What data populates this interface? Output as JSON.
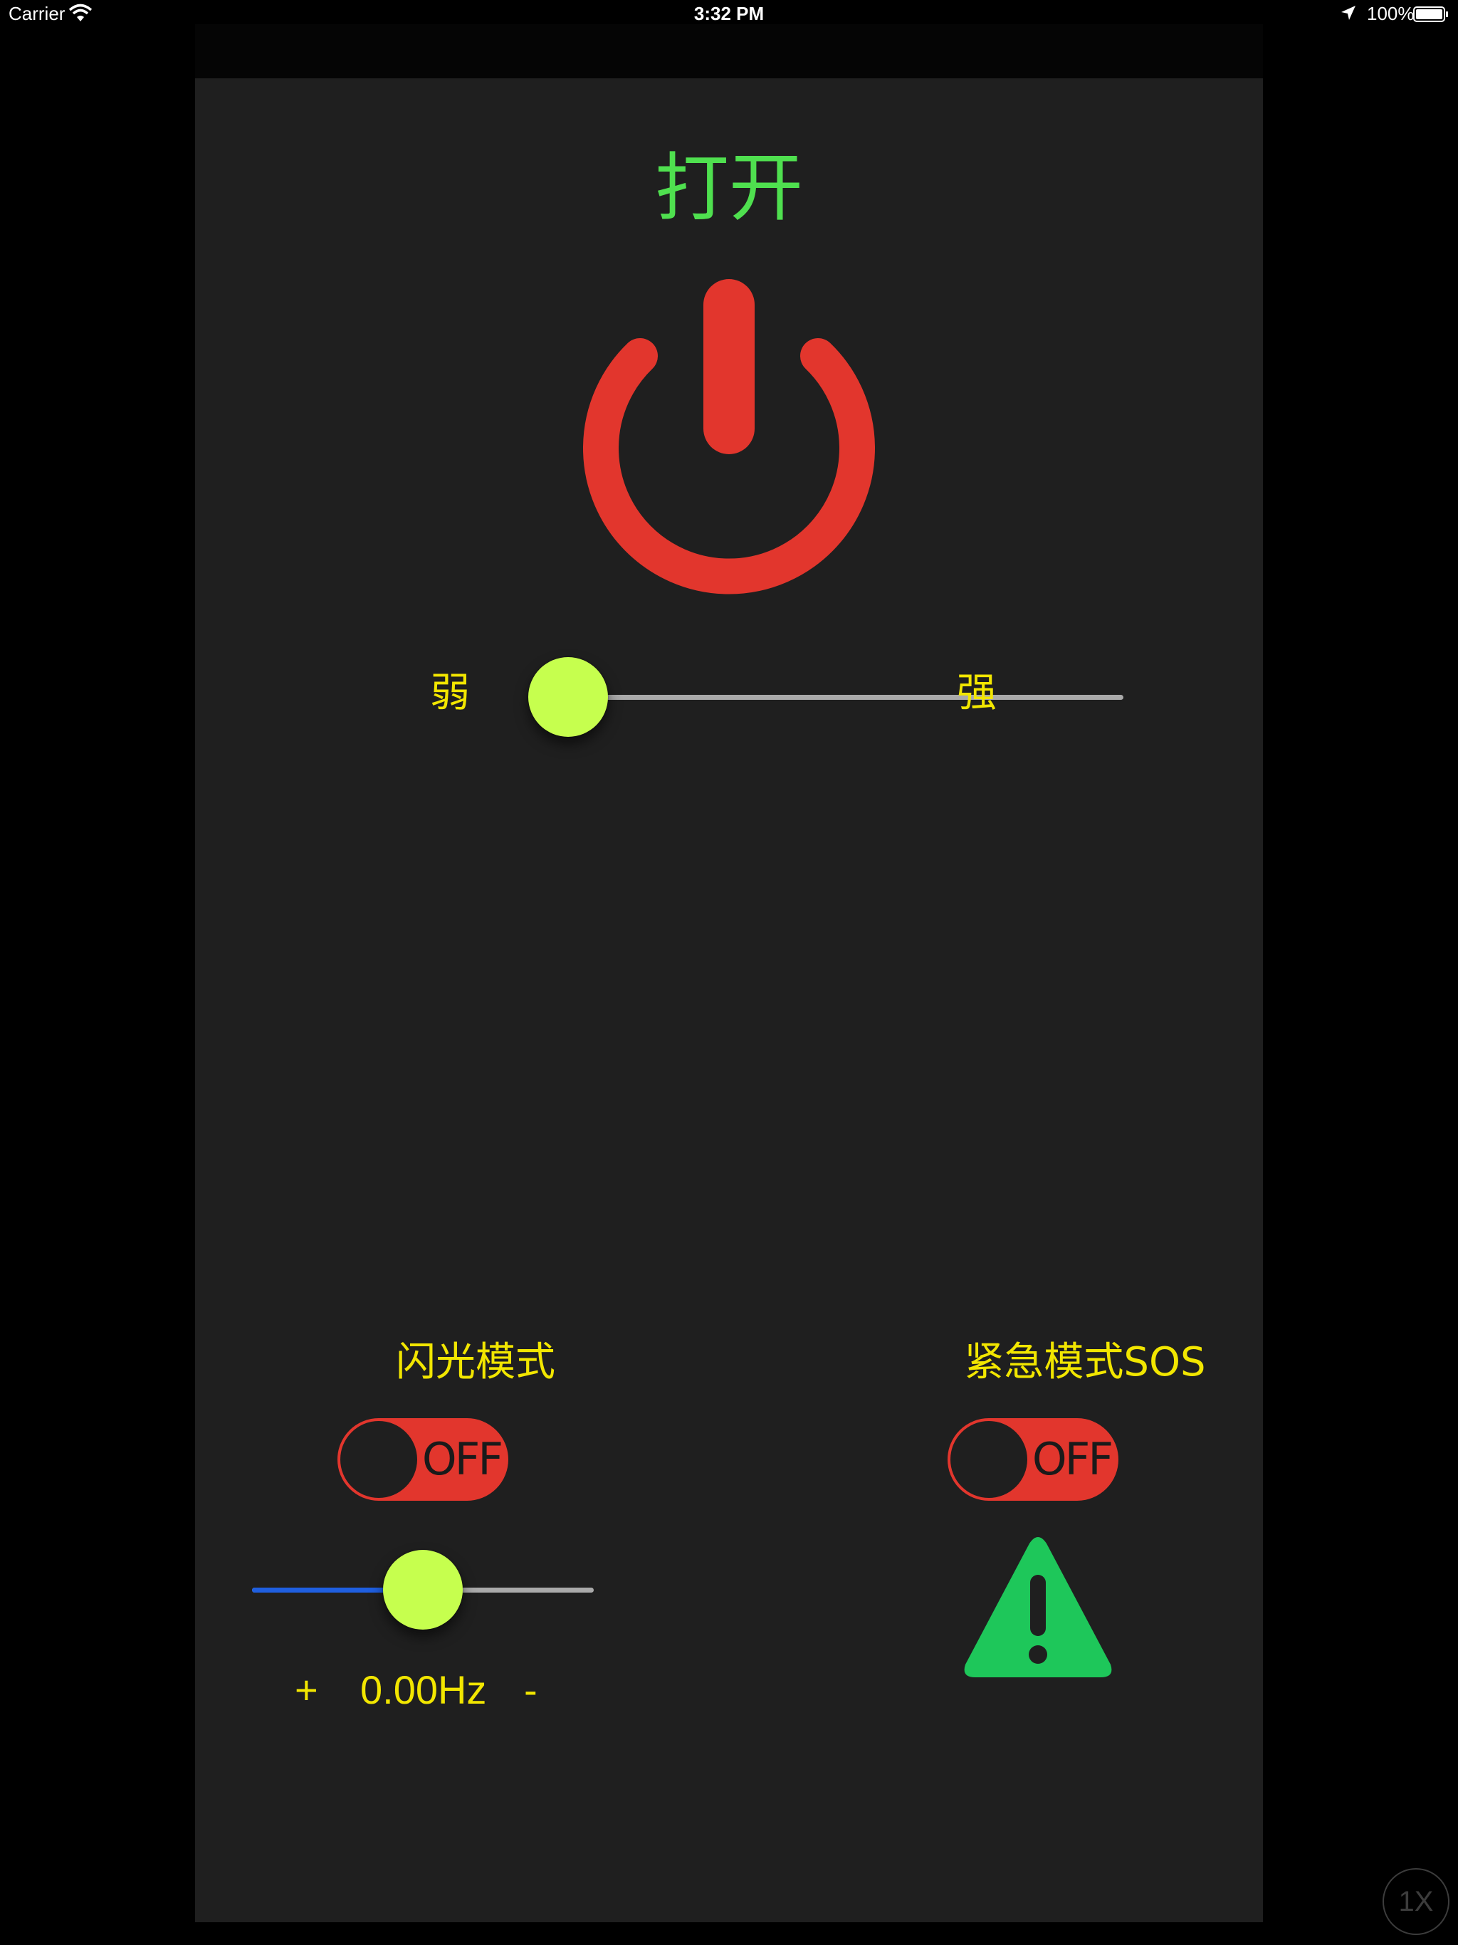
{
  "status_bar": {
    "carrier": "Carrier",
    "time": "3:32 PM",
    "battery_percent": "100%",
    "icons": [
      "wifi-icon",
      "location-arrow-icon",
      "battery-icon"
    ]
  },
  "power": {
    "title": "打开",
    "icon": "power-icon",
    "icon_color": "#e2362d",
    "title_color": "#4fe04f"
  },
  "brightness": {
    "min_label": "弱",
    "max_label": "强",
    "value_fraction": 0.0
  },
  "flash_mode": {
    "title": "闪光模式",
    "toggle_label": "OFF",
    "toggle_on": false,
    "frequency_fraction": 0.5,
    "plus_label": "+",
    "frequency_value": "0.00Hz",
    "minus_label": "-"
  },
  "sos_mode": {
    "title": "紧急模式SOS",
    "toggle_label": "OFF",
    "toggle_on": false,
    "icon": "warning-icon",
    "icon_color": "#1ec75a"
  },
  "colors": {
    "background": "#1f1f1f",
    "label_yellow": "#f2e600",
    "knob": "#c6ff4e",
    "toggle_off": "#e2362d",
    "slider_min_track": "#1f5fe0",
    "slider_max_track": "#aaaaaa"
  },
  "zoom_badge": "1X"
}
